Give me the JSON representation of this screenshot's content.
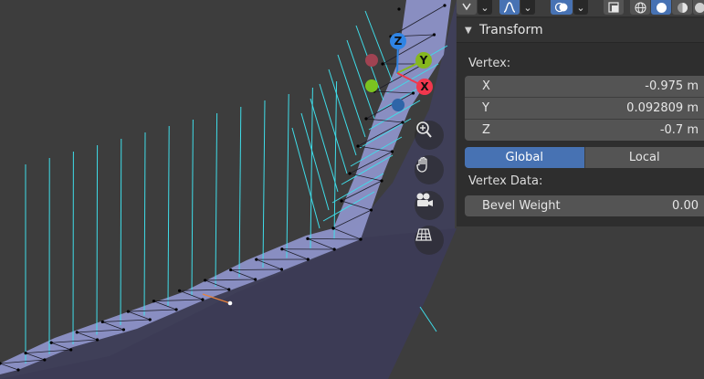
{
  "header": {
    "items": [
      "",
      "",
      "",
      "",
      "",
      "",
      "",
      ""
    ]
  },
  "panel": {
    "title": "Transform",
    "vertex_label": "Vertex:",
    "fields": [
      {
        "label": "X",
        "value": "-0.975 m"
      },
      {
        "label": "Y",
        "value": "0.092809 m"
      },
      {
        "label": "Z",
        "value": "-0.7 m"
      }
    ],
    "space_toggle": {
      "global": "Global",
      "local": "Local"
    },
    "vertex_data_label": "Vertex Data:",
    "bevel_weight": {
      "label": "Bevel Weight",
      "value": "0.00"
    }
  },
  "gizmo": {
    "x": "X",
    "y": "Y",
    "z": "Z",
    "colors": {
      "x": "#f2374d",
      "y": "#86b71f",
      "z": "#2f84e4"
    }
  },
  "nav_icons": [
    "zoom-icon",
    "pan-hand-icon",
    "camera-icon",
    "perspective-grid-icon"
  ],
  "colors": {
    "accent": "#4772b3",
    "mesh_face": "#8b8fc2",
    "normals": "#3fdde9",
    "background": "#3d3d3d"
  }
}
